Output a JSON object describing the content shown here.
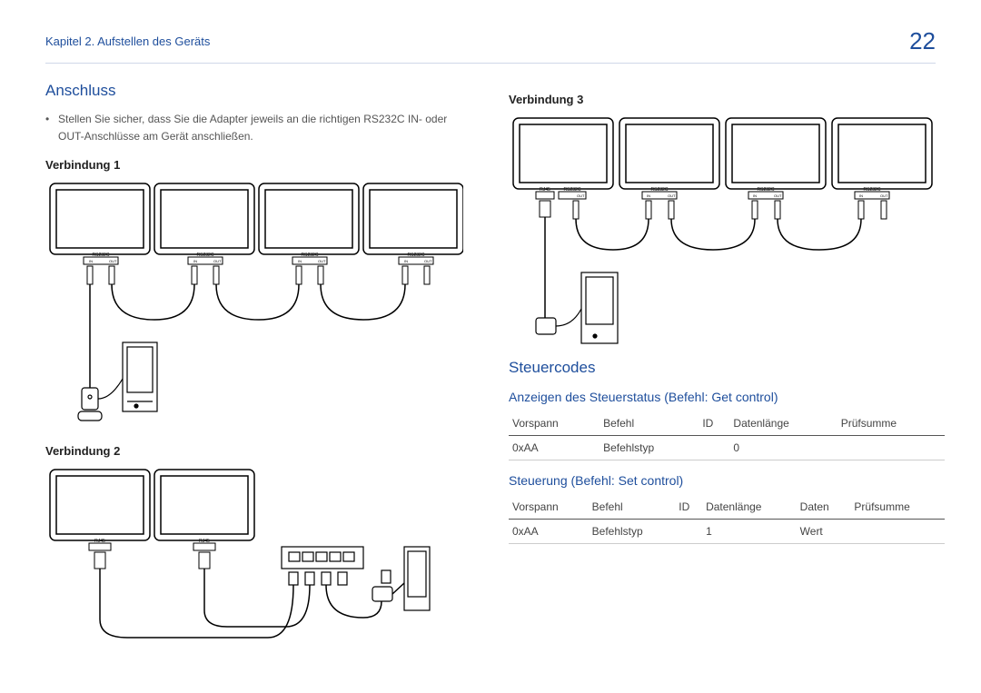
{
  "header": {
    "chapter": "Kapitel 2. Aufstellen des Geräts",
    "page": "22"
  },
  "left": {
    "title": "Anschluss",
    "note": "Stellen Sie sicher, dass Sie die Adapter jeweils an die richtigen RS232C IN- oder OUT-Anschlüsse am Gerät anschließen.",
    "conn1": "Verbindung 1",
    "conn2": "Verbindung 2"
  },
  "right": {
    "conn3": "Verbindung 3",
    "codesTitle": "Steuercodes",
    "sub1": "Anzeigen des Steuerstatus (Befehl: Get control)",
    "table1": {
      "h": [
        "Vorspann",
        "Befehl",
        "ID",
        "Datenlänge",
        "Prüfsumme"
      ],
      "r": [
        "0xAA",
        "Befehlstyp",
        "",
        "0",
        ""
      ]
    },
    "sub2": "Steuerung (Befehl: Set control)",
    "table2": {
      "h": [
        "Vorspann",
        "Befehl",
        "ID",
        "Datenlänge",
        "Daten",
        "Prüfsumme"
      ],
      "r": [
        "0xAA",
        "Befehlstyp",
        "",
        "1",
        "Wert",
        ""
      ]
    }
  },
  "labels": {
    "rs232c": "RS232C",
    "rj45": "RJ45",
    "in": "IN",
    "out": "OUT"
  }
}
